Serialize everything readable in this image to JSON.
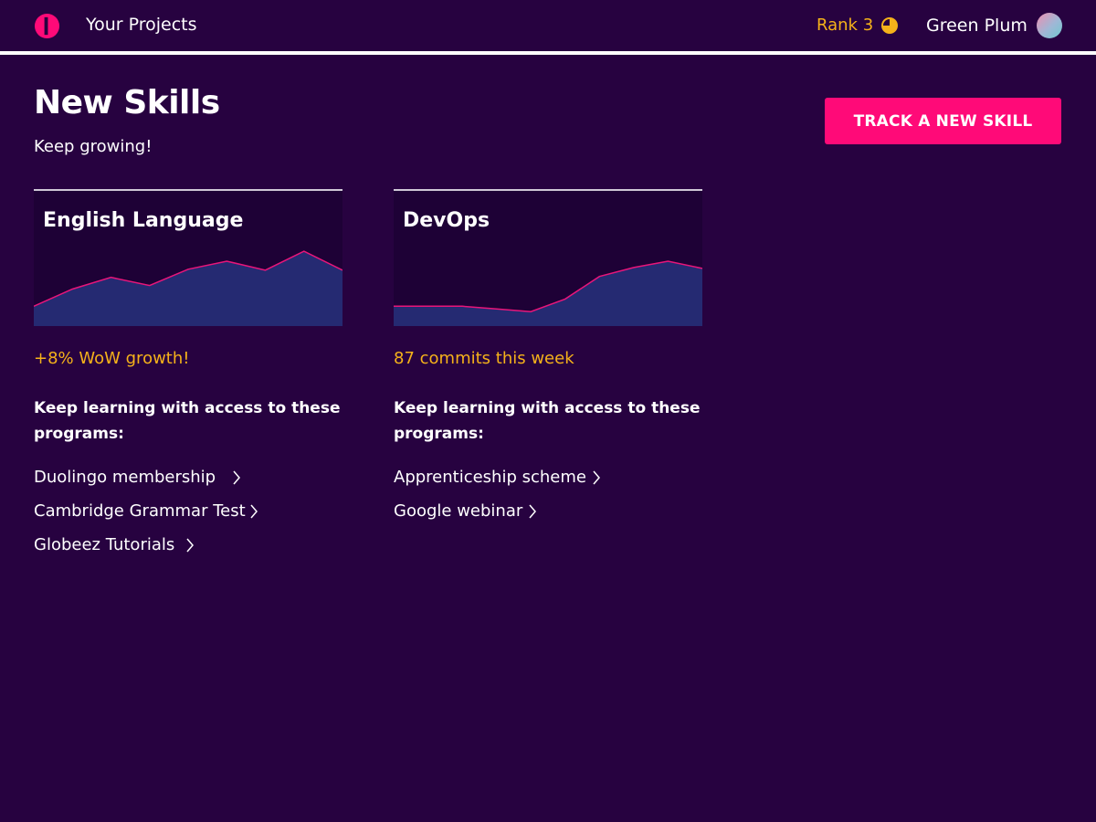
{
  "header": {
    "nav_link": "Your Projects",
    "rank_label": "Rank 3",
    "user_name": "Green Plum"
  },
  "page": {
    "title": "New Skills",
    "subtitle": "Keep growing!",
    "cta_label": "TRACK A NEW SKILL"
  },
  "colors": {
    "background": "#270240",
    "accent": "#ff0a78",
    "highlight": "#f5b21a",
    "chart_fill": "#252a72",
    "chart_line": "#e8157a"
  },
  "cards": [
    {
      "title": "English Language",
      "stat": "+8% WoW growth!",
      "programs_heading": "Keep learning with access to these programs:",
      "programs": [
        {
          "label": "Duolingo membership"
        },
        {
          "label": "Cambridge Grammar Test"
        },
        {
          "label": "Globeez Tutorials"
        }
      ]
    },
    {
      "title": "DevOps",
      "stat": "87 commits this week",
      "programs_heading": "Keep learning with access to these programs:",
      "programs": [
        {
          "label": "Apprenticeship scheme"
        },
        {
          "label": "Google webinar"
        }
      ]
    }
  ],
  "chart_data": [
    {
      "type": "area",
      "values": [
        22,
        41,
        54,
        45,
        63,
        72,
        62,
        83,
        62
      ],
      "ylim": [
        0,
        150
      ]
    },
    {
      "type": "area",
      "values": [
        22,
        22,
        22,
        19,
        16,
        30,
        55,
        65,
        72,
        64
      ],
      "ylim": [
        0,
        150
      ]
    }
  ]
}
